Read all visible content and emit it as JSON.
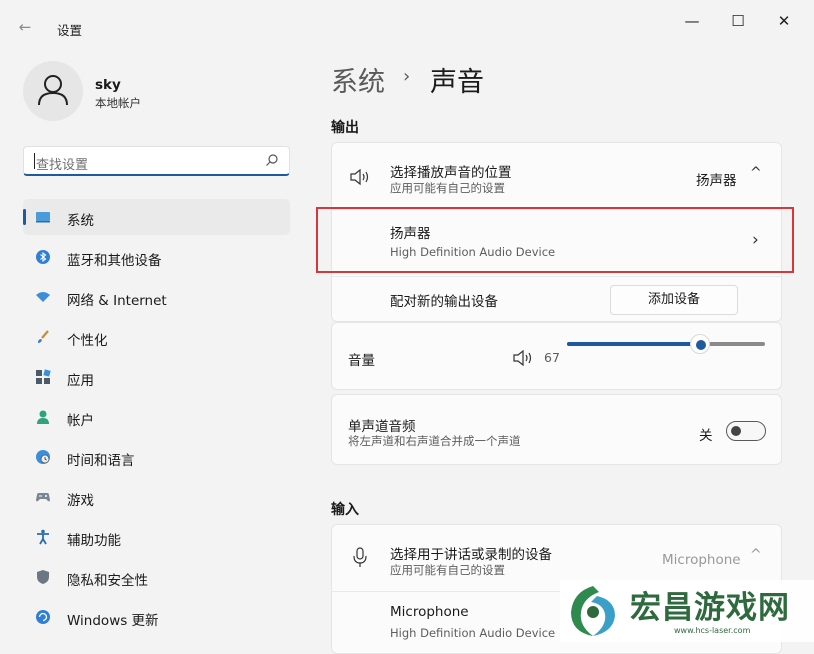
{
  "window": {
    "title": "设置",
    "minimize": "—",
    "maximize": "☐",
    "close": "✕"
  },
  "user": {
    "name": "sky",
    "account": "本地帐户"
  },
  "search": {
    "placeholder": "查找设置"
  },
  "nav": [
    {
      "label": "系统",
      "icon": "monitor-icon",
      "active": true
    },
    {
      "label": "蓝牙和其他设备",
      "icon": "bluetooth-icon"
    },
    {
      "label": "网络 & Internet",
      "icon": "wifi-icon"
    },
    {
      "label": "个性化",
      "icon": "brush-icon"
    },
    {
      "label": "应用",
      "icon": "apps-icon"
    },
    {
      "label": "帐户",
      "icon": "person-icon"
    },
    {
      "label": "时间和语言",
      "icon": "clock-globe-icon"
    },
    {
      "label": "游戏",
      "icon": "gamepad-icon"
    },
    {
      "label": "辅助功能",
      "icon": "accessibility-icon"
    },
    {
      "label": "隐私和安全性",
      "icon": "shield-icon"
    },
    {
      "label": "Windows 更新",
      "icon": "update-icon"
    }
  ],
  "breadcrumb": {
    "parent": "系统",
    "separator": "›",
    "current": "声音"
  },
  "output": {
    "section_title": "输出",
    "choose_title": "选择播放声音的位置",
    "choose_sub": "应用可能有自己的设置",
    "choose_value": "扬声器",
    "device_name": "扬声器",
    "device_desc": "High Definition Audio Device",
    "pair_label": "配对新的输出设备",
    "add_button": "添加设备"
  },
  "volume": {
    "label": "音量",
    "value": 67
  },
  "mono": {
    "title": "单声道音频",
    "sub": "将左声道和右声道合并成一个声道",
    "state_label": "关",
    "on": false
  },
  "input": {
    "section_title": "输入",
    "choose_title": "选择用于讲话或录制的设备",
    "choose_sub": "应用可能有自己的设置",
    "choose_value": "Microphone",
    "device_name": "Microphone",
    "device_desc": "High Definition Audio Device"
  },
  "watermark": {
    "text": "宏昌游戏网",
    "url": "www.hcs-laser.com"
  },
  "colors": {
    "accent": "#1f5a9e",
    "highlight": "#d3393c",
    "watermark": "#2e6a3e"
  }
}
